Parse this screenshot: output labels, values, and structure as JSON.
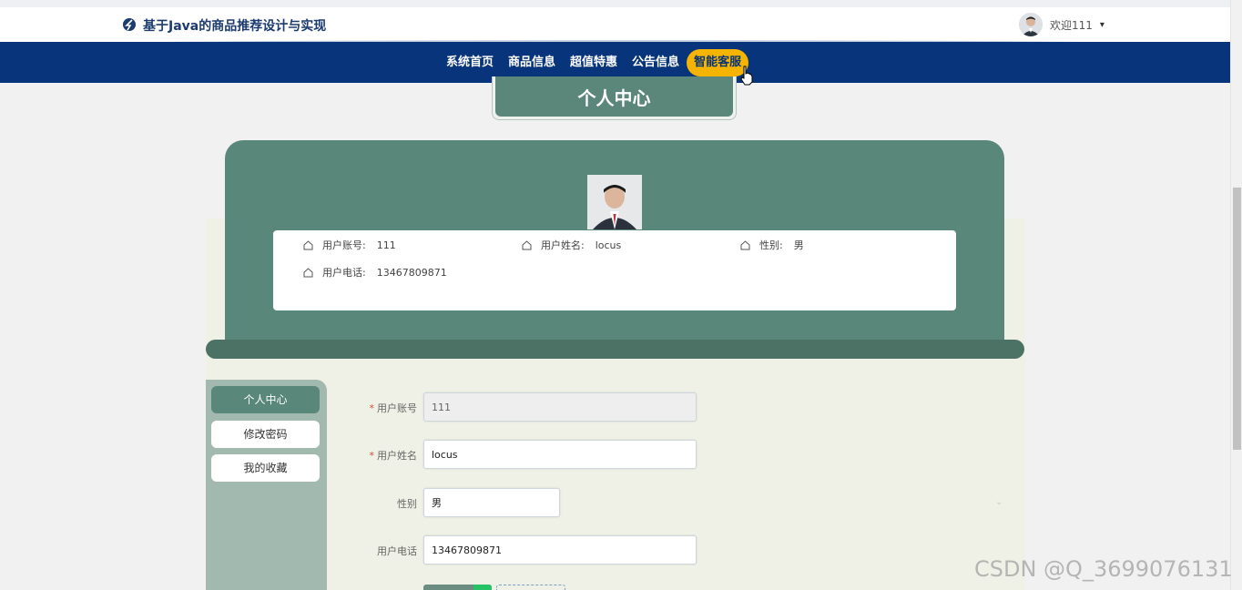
{
  "header": {
    "app_title": "基于Java的商品推荐设计与实现",
    "welcome_text": "欢迎111",
    "caret": "▾"
  },
  "nav": {
    "items": [
      {
        "label": "系统首页"
      },
      {
        "label": "商品信息"
      },
      {
        "label": "超值特惠"
      },
      {
        "label": "公告信息"
      },
      {
        "label": "智能客服"
      }
    ],
    "active_index": 4
  },
  "page_title": "个人中心",
  "profile": {
    "account_label": "用户账号:",
    "account_value": "111",
    "name_label": "用户姓名:",
    "name_value": "locus",
    "gender_label": "性别:",
    "gender_value": "男",
    "phone_label": "用户电话:",
    "phone_value": "13467809871"
  },
  "sidebar": {
    "items": [
      {
        "label": "个人中心"
      },
      {
        "label": "修改密码"
      },
      {
        "label": "我的收藏"
      }
    ]
  },
  "form": {
    "required_mark": "*",
    "account_label": "用户账号",
    "account_value": "111",
    "name_label": "用户姓名",
    "name_value": "locus",
    "gender_label": "性别",
    "gender_value": "男",
    "phone_label": "用户电话",
    "phone_value": "13467809871"
  },
  "watermark": "CSDN @Q_3699076131",
  "colors": {
    "navbar": "#07347a",
    "active_nav": "#f4b400",
    "primary_green": "#598779",
    "cream": "#f0f1e6"
  }
}
